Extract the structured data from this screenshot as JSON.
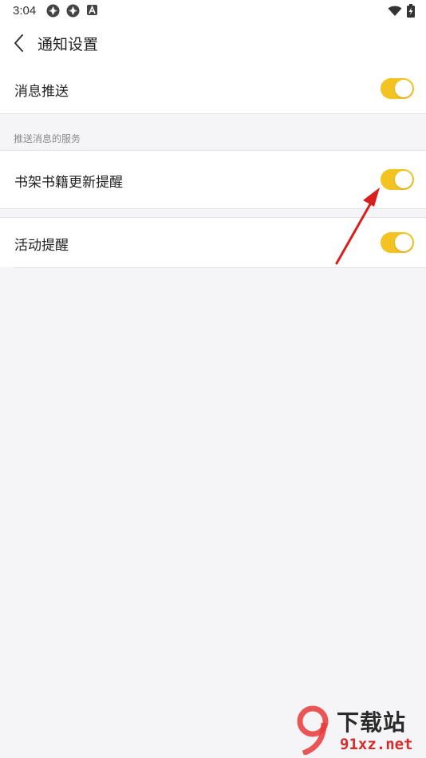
{
  "status_bar": {
    "time": "3:04",
    "left_icons": [
      "app-notification-icon",
      "app-notification-icon",
      "app-notification-a-icon"
    ],
    "right_icons": [
      "wifi-icon",
      "battery-charging-icon"
    ]
  },
  "header": {
    "title": "通知设置",
    "back_icon": "chevron-left-icon"
  },
  "settings": {
    "push_messages": {
      "label": "消息推送",
      "enabled": true
    },
    "section_title": "推送消息的服务",
    "bookshelf_update": {
      "label": "书架书籍更新提醒",
      "enabled": true
    },
    "activity_reminder": {
      "label": "活动提醒",
      "enabled": true
    }
  },
  "watermark": {
    "brand_mark": "9",
    "brand_text": "下载站",
    "site": "91xz.net"
  },
  "colors": {
    "toggle_on": "#f3c322",
    "annotation_arrow": "#d81f1f",
    "background": "#f5f5f7"
  }
}
